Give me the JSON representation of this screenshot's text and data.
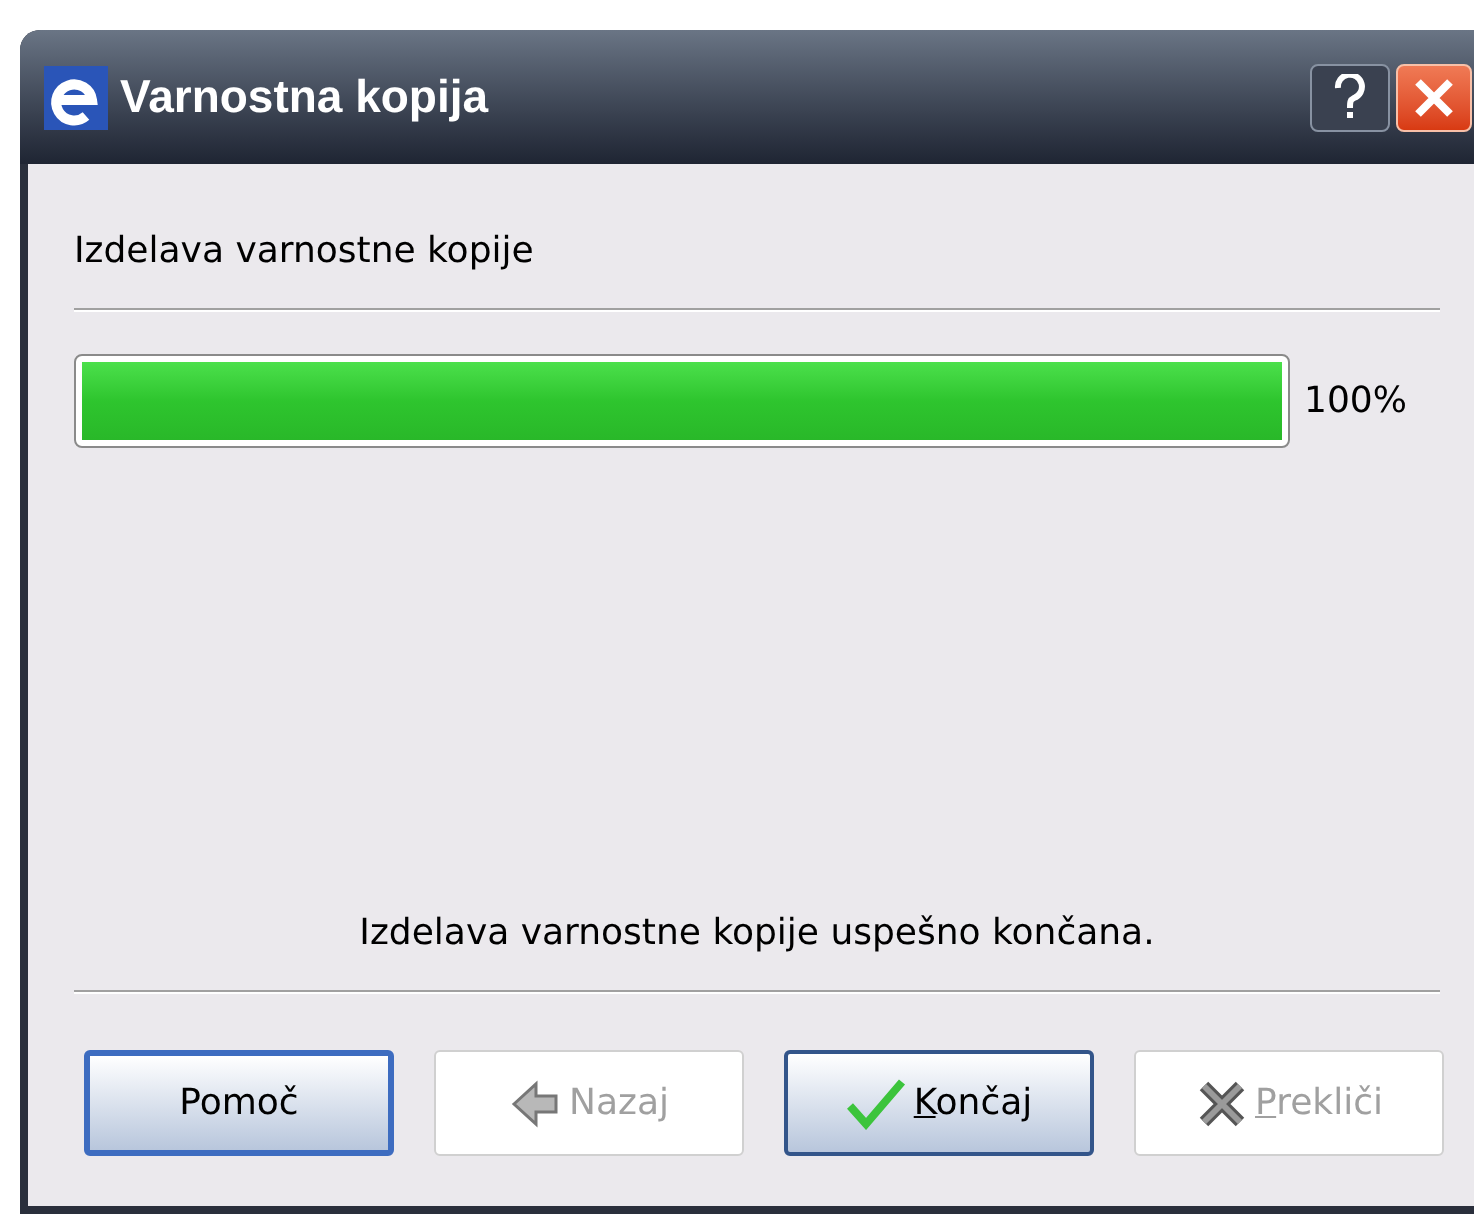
{
  "window": {
    "title": "Varnostna kopija"
  },
  "header": "Izdelava varnostne kopije",
  "progress": {
    "level": 1,
    "reading": "100%"
  },
  "message": "Izdelava varnostne kopije uspešno končana.",
  "buttons": [
    {
      "label": "Pomoč",
      "kind": "plain",
      "disabled": false,
      "focused": true,
      "mnemonic": false
    },
    {
      "label": "Nazaj",
      "kind": "back",
      "disabled": true,
      "focused": false,
      "mnemonic": false
    },
    {
      "label": "Končaj",
      "kind": "finish",
      "disabled": false,
      "focused": false,
      "mnemonic": true
    },
    {
      "label": "Prekliči",
      "kind": "cancel",
      "disabled": true,
      "focused": false,
      "mnemonic": true
    }
  ]
}
